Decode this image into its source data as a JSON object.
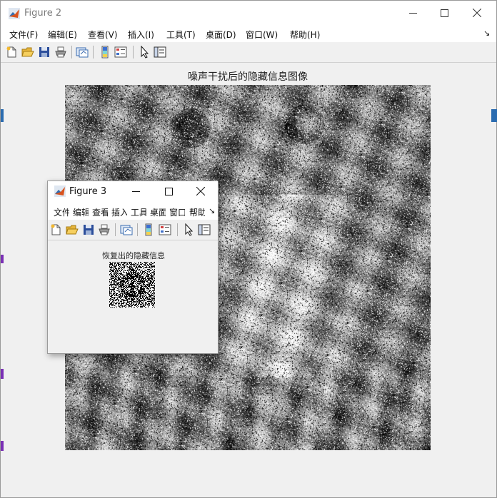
{
  "figure2": {
    "title": "Figure 2",
    "menu": [
      "文件(F)",
      "编辑(E)",
      "查看(V)",
      "插入(I)",
      "工具(T)",
      "桌面(D)",
      "窗口(W)",
      "帮助(H)"
    ],
    "menu_arrow": "↘",
    "axes_title": "噪声干扰后的隐藏信息图像",
    "image_description_icon": "noisy-baboon-image"
  },
  "figure3": {
    "title": "Figure 3",
    "menu": [
      "文件",
      "编辑",
      "查看",
      "插入",
      "工具",
      "桌面",
      "窗口",
      "帮助"
    ],
    "menu_arrow": "↘",
    "axes_title": "恢复出的隐藏信息",
    "image_description_icon": "recovered-noise-image"
  },
  "colors": {
    "accent": "#1e5fb4",
    "window_bg": "#f0f0f0",
    "titlebar": "#ffffff"
  }
}
